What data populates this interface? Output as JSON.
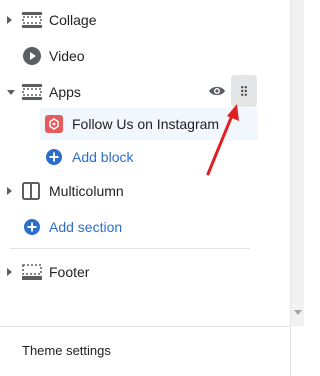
{
  "sidebar": {
    "items": [
      {
        "label": "Collage",
        "icon": "collage-section-icon",
        "expand": "collapsed"
      },
      {
        "label": "Video",
        "icon": "video-play-icon",
        "expand": "none"
      },
      {
        "label": "Apps",
        "icon": "apps-section-icon",
        "expand": "expanded"
      },
      {
        "label": "Multicolumn",
        "icon": "multicolumn-icon",
        "expand": "collapsed"
      },
      {
        "label": "Footer",
        "icon": "footer-icon",
        "expand": "collapsed"
      }
    ],
    "block": {
      "label": "Follow Us on Instagram",
      "icon": "instagram-app-icon",
      "icon_color": "#e55b5b"
    },
    "add_block_label": "Add block",
    "add_section_label": "Add section",
    "theme_settings_label": "Theme settings"
  },
  "colors": {
    "link": "#2c6ecb",
    "arrow": "#e02020",
    "selected_bg": "#f2f7fe"
  },
  "annotation": {
    "arrow_target": "drag-handle-icon"
  }
}
